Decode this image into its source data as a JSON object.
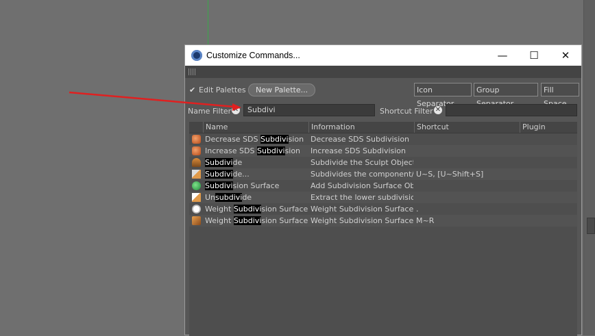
{
  "window": {
    "title": "Customize Commands...",
    "controls": {
      "minimize": "—",
      "maximize": "☐",
      "close": "✕"
    }
  },
  "toolbar": {
    "edit_palettes_label": "Edit Palettes",
    "new_palette_label": "New Palette...",
    "icon_separator_label": "Icon Separator",
    "group_separator_label": "Group Separator",
    "fill_space_label": "Fill Space"
  },
  "filters": {
    "name_filter_label": "Name Filter",
    "name_filter_value": "Subdivi",
    "shortcut_filter_label": "Shortcut Filter",
    "shortcut_filter_value": ""
  },
  "table": {
    "columns": [
      "Name",
      "Information",
      "Shortcut",
      "Plugin"
    ],
    "rows": [
      {
        "name_pre": "Decrease SDS ",
        "name_match": "Subdivi",
        "name_post": "sion",
        "info": "Decrease SDS Subdivision",
        "shortcut": "",
        "plugin": "",
        "icon": "decrease-sds-icon"
      },
      {
        "name_pre": "Increase SDS ",
        "name_match": "Subdivi",
        "name_post": "sion",
        "info": "Increase SDS Subdivision",
        "shortcut": "",
        "plugin": "",
        "icon": "increase-sds-icon"
      },
      {
        "name_pre": "",
        "name_match": "Subdivi",
        "name_post": "de",
        "info": "Subdivide the Sculpt Object u",
        "shortcut": "",
        "plugin": "",
        "icon": "sculpt-subdivide-icon"
      },
      {
        "name_pre": "",
        "name_match": "Subdivi",
        "name_post": "de...",
        "info": "Subdivides the component/o",
        "shortcut": "U~S, [U~Shift+S]",
        "plugin": "",
        "icon": "subdivide-icon"
      },
      {
        "name_pre": "",
        "name_match": "Subdivi",
        "name_post": "sion Surface",
        "info": "Add Subdivision Surface Obje",
        "shortcut": "",
        "plugin": "",
        "icon": "subdivision-surface-icon"
      },
      {
        "name_pre": "Un",
        "name_match": "subdivi",
        "name_post": "de",
        "info": "Extract the lower subdivision",
        "shortcut": "",
        "plugin": "",
        "icon": "unsubdivide-icon"
      },
      {
        "name_pre": "Weight ",
        "name_match": "Subdivi",
        "name_post": "sion Surface",
        "info": "Weight Subdivision Surface",
        "shortcut": ".",
        "plugin": "",
        "icon": "weight-sds-icon"
      },
      {
        "name_pre": "Weight ",
        "name_match": "Subdivi",
        "name_post": "sion Surface",
        "info": "Weight Subdivision Surface",
        "shortcut": "M~R",
        "plugin": "",
        "icon": "weight-sds-brush-icon"
      }
    ]
  },
  "colors": {
    "annotation_arrow": "#e02020",
    "highlight_bg": "#000000",
    "viewport_bg": "#6f6f6f"
  }
}
